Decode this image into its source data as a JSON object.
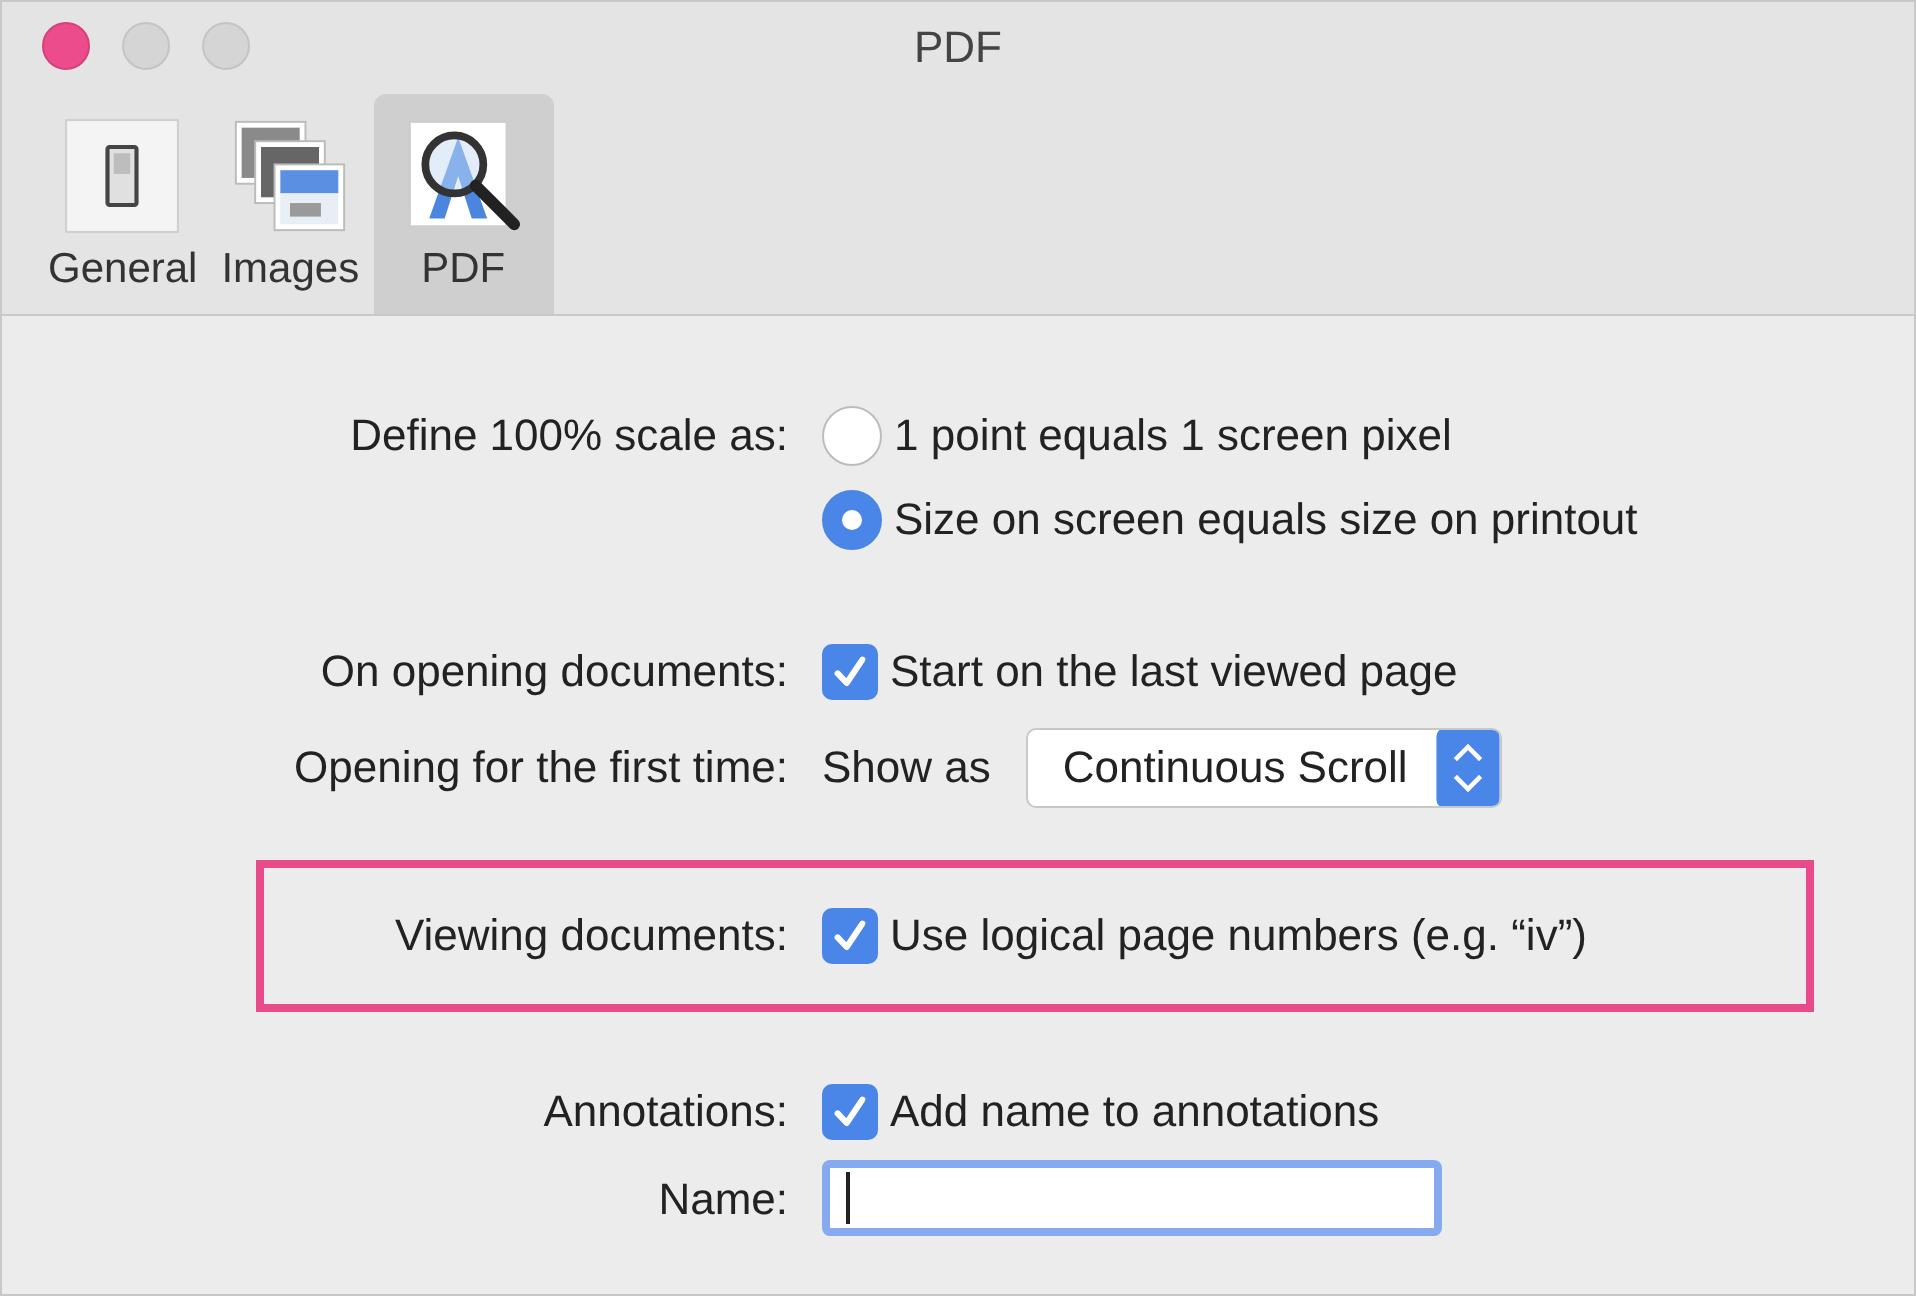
{
  "window": {
    "title": "PDF"
  },
  "toolbar": {
    "tabs": [
      {
        "label": "General",
        "selected": false
      },
      {
        "label": "Images",
        "selected": false
      },
      {
        "label": "PDF",
        "selected": true
      }
    ]
  },
  "rows": [
    {
      "kind": "radio_group",
      "label": "Define 100% scale as:",
      "highlighted": false,
      "options": [
        {
          "label": "1 point equals 1 screen pixel",
          "selected": false
        },
        {
          "label": "Size on screen equals size on printout",
          "selected": true
        }
      ]
    },
    {
      "kind": "checkbox",
      "label": "On opening documents:",
      "highlighted": false,
      "checkbox": {
        "label": "Start on the last viewed page",
        "checked": true
      }
    },
    {
      "kind": "popup",
      "label": "Opening for the first time:",
      "highlighted": false,
      "prefix": "Show as",
      "value": "Continuous Scroll"
    },
    {
      "kind": "checkbox",
      "label": "Viewing documents:",
      "highlighted": true,
      "checkbox": {
        "label": "Use logical page numbers (e.g. “iv”)",
        "checked": true
      }
    },
    {
      "kind": "checkbox",
      "label": "Annotations:",
      "highlighted": false,
      "checkbox": {
        "label": "Add name to annotations",
        "checked": true
      }
    },
    {
      "kind": "text_field",
      "label": "Name:",
      "highlighted": false,
      "focused": true
    }
  ]
}
